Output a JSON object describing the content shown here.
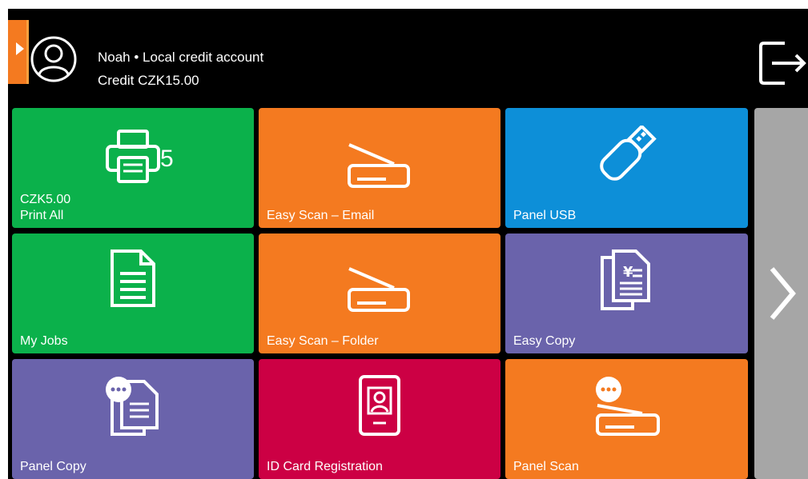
{
  "header": {
    "user_text": "Noah • Local credit account",
    "credit_text": "Credit CZK15.00"
  },
  "colors": {
    "green": "#0bb14b",
    "orange": "#f47a20",
    "blue": "#0d8fd8",
    "purple": "#6a63ab",
    "crimson": "#cc0044",
    "pager_gray": "#a6a6a6"
  },
  "tiles": [
    {
      "label": "Print All",
      "sub": "CZK5.00",
      "count": "5",
      "icon": "printer-icon"
    },
    {
      "label": "Easy Scan – Email",
      "icon": "scanner-icon"
    },
    {
      "label": "Panel USB",
      "icon": "usb-drive-icon"
    },
    {
      "label": "My Jobs",
      "icon": "document-icon"
    },
    {
      "label": "Easy Scan – Folder",
      "icon": "scanner-icon"
    },
    {
      "label": "Easy Copy",
      "icon": "copy-document-icon"
    },
    {
      "label": "Panel Copy",
      "icon": "panel-copy-icon"
    },
    {
      "label": "ID Card Registration",
      "icon": "id-card-icon"
    },
    {
      "label": "Panel Scan",
      "icon": "panel-scan-icon"
    }
  ],
  "pager": {
    "icon": "chevron-right-icon"
  }
}
